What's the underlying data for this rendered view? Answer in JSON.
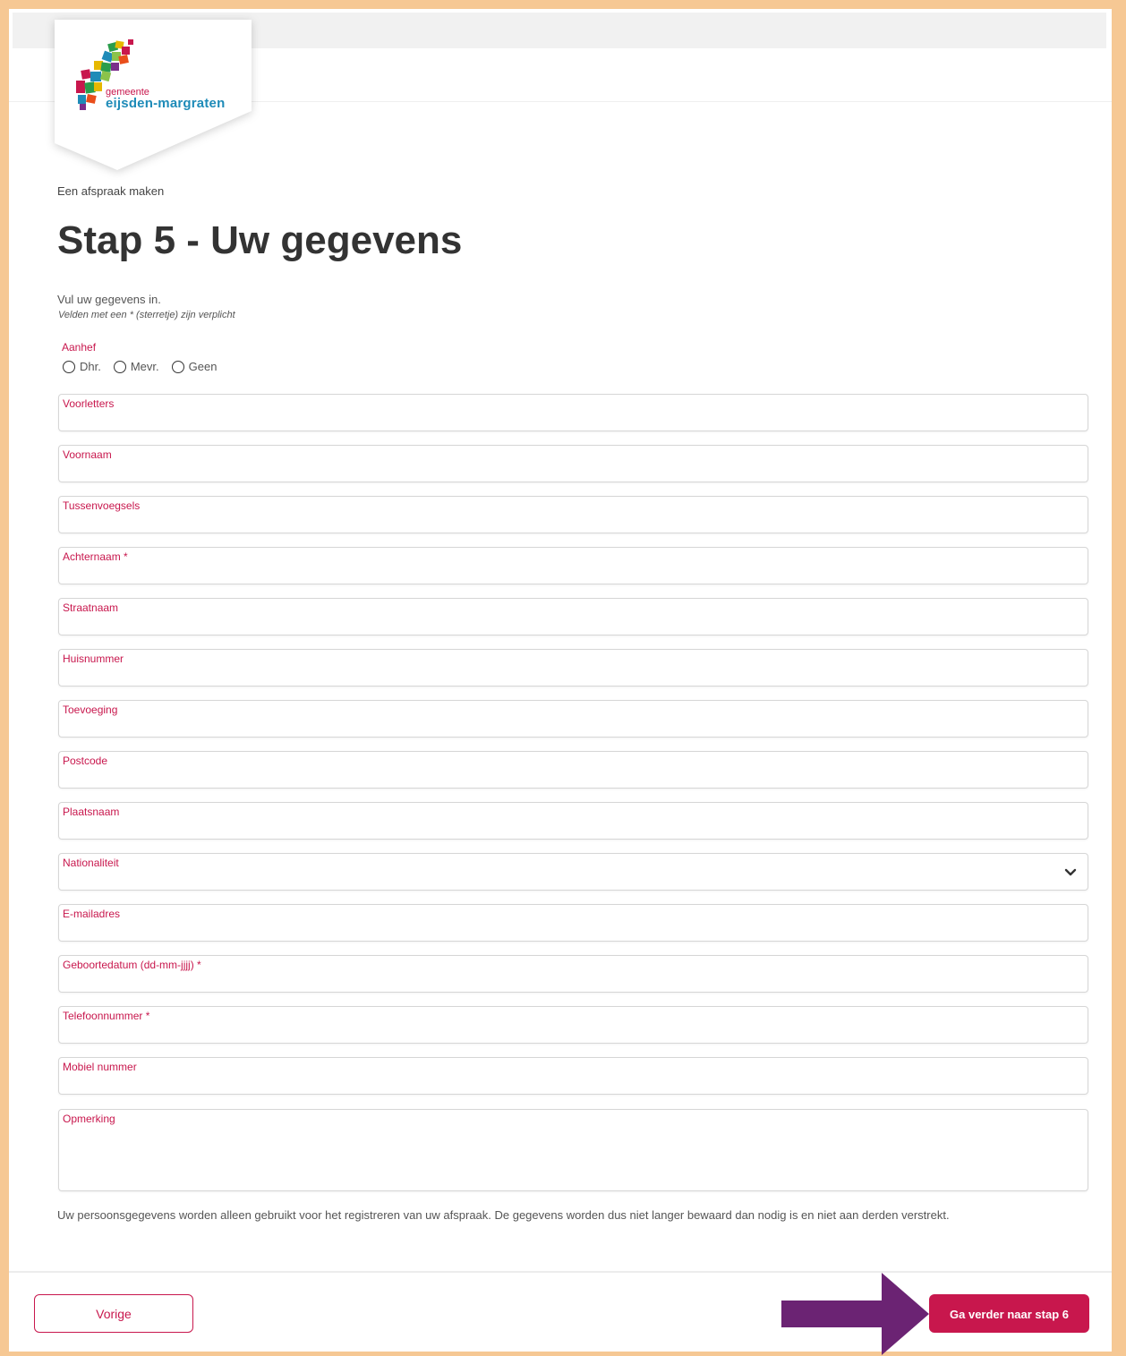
{
  "logo": {
    "line1": "gemeente",
    "line2": "eijsden-margraten"
  },
  "breadcrumb": "Een afspraak maken",
  "title": "Stap 5 - Uw gegevens",
  "intro": "Vul uw gegevens in.",
  "required_note": "Velden met een * (sterretje) zijn verplicht",
  "salutation": {
    "label": "Aanhef",
    "options": [
      "Dhr.",
      "Mevr.",
      "Geen"
    ]
  },
  "fields": {
    "initials": "Voorletters",
    "first_name": "Voornaam",
    "infix": "Tussenvoegsels",
    "last_name": "Achternaam *",
    "street": "Straatnaam",
    "house_number": "Huisnummer",
    "addition": "Toevoeging",
    "postcode": "Postcode",
    "city": "Plaatsnaam",
    "nationality": "Nationaliteit",
    "email": "E-mailadres",
    "birthdate": "Geboortedatum (dd-mm-jjjj) *",
    "phone": "Telefoonnummer *",
    "mobile": "Mobiel nummer",
    "remark": "Opmerking"
  },
  "privacy": "Uw persoonsgegevens worden alleen gebruikt voor het registreren van uw afspraak. De gegevens worden dus niet langer bewaard dan nodig is en niet aan derden verstrekt.",
  "buttons": {
    "prev": "Vorige",
    "next": "Ga verder naar stap 6"
  },
  "colors": {
    "accent": "#c8174d",
    "frame": "#f6c894",
    "arrow": "#6b2373"
  }
}
